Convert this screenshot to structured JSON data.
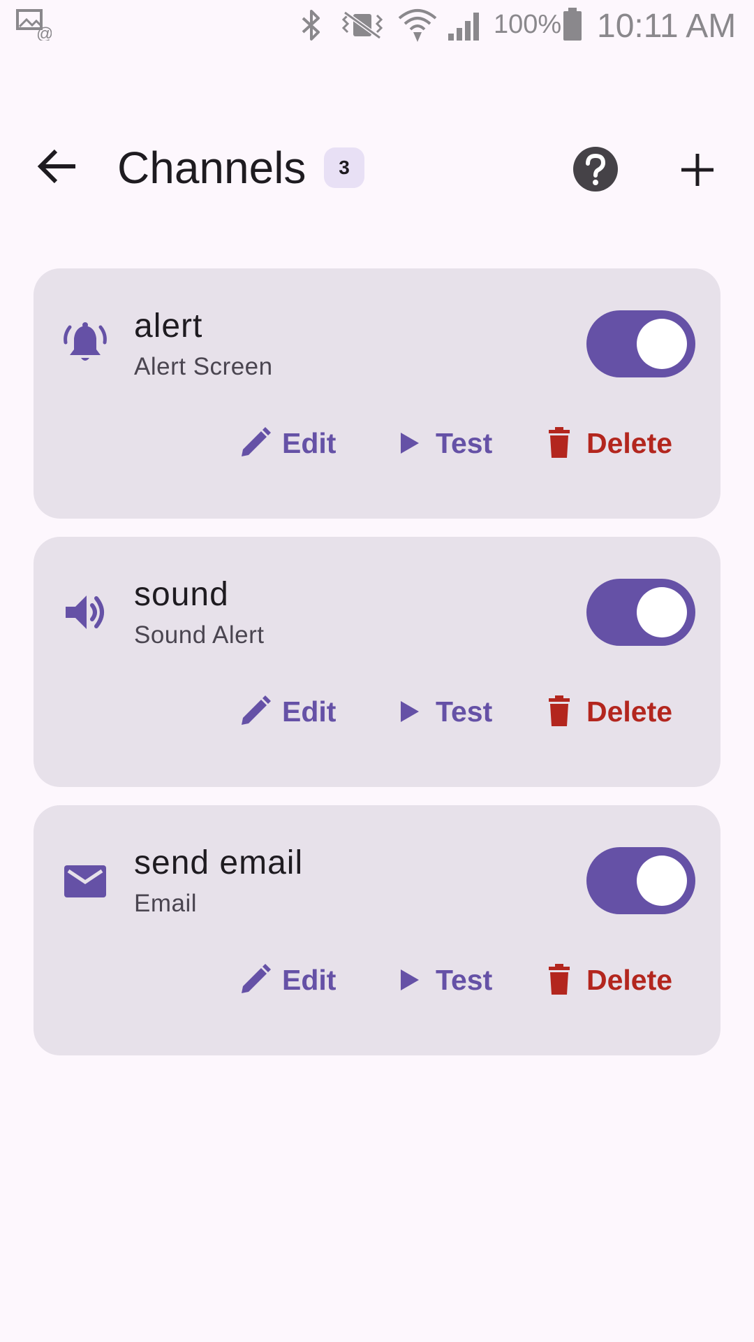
{
  "status_bar": {
    "battery": "100%",
    "time": "10:11 AM"
  },
  "header": {
    "title": "Channels",
    "count": "3"
  },
  "channels": [
    {
      "name": "alert",
      "type": "Alert Screen",
      "icon": "bell-icon",
      "enabled": true
    },
    {
      "name": "sound",
      "type": "Sound Alert",
      "icon": "speaker-icon",
      "enabled": true
    },
    {
      "name": "send email",
      "type": "Email",
      "icon": "mail-icon",
      "enabled": true
    }
  ],
  "actions": {
    "edit": "Edit",
    "test": "Test",
    "delete": "Delete"
  },
  "colors": {
    "accent": "#6551a6",
    "danger": "#b3261e",
    "card": "#e7e1ea",
    "background": "#fdf7fd"
  }
}
